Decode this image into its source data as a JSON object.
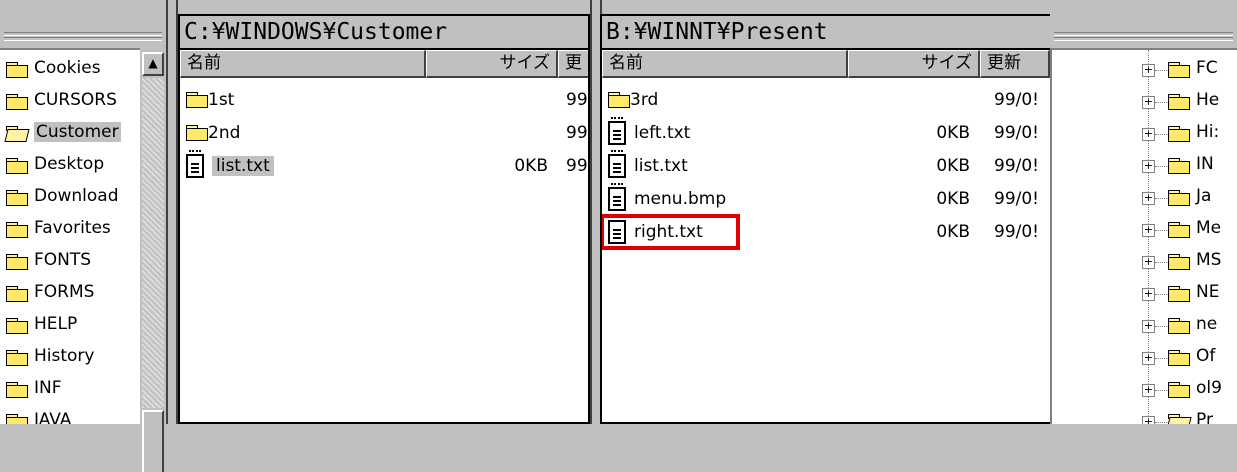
{
  "left_tree": {
    "items": [
      {
        "label": "Cookies",
        "selected": false
      },
      {
        "label": "CURSORS",
        "selected": false
      },
      {
        "label": "Customer",
        "selected": true
      },
      {
        "label": "Desktop",
        "selected": false
      },
      {
        "label": "Download",
        "selected": false
      },
      {
        "label": "Favorites",
        "selected": false
      },
      {
        "label": "FONTS",
        "selected": false
      },
      {
        "label": "FORMS",
        "selected": false
      },
      {
        "label": "HELP",
        "selected": false
      },
      {
        "label": "History",
        "selected": false
      },
      {
        "label": "INF",
        "selected": false
      },
      {
        "label": "JAVA",
        "selected": false
      }
    ],
    "scroll_up_glyph": "▲"
  },
  "left_panel": {
    "path": "C:¥WINDOWS¥Customer",
    "headers": {
      "name": "名前",
      "size": "サイズ",
      "date": "更"
    },
    "rows": [
      {
        "type": "folder",
        "name": "1st",
        "size": "",
        "date": "99"
      },
      {
        "type": "folder",
        "name": "2nd",
        "size": "",
        "date": "99"
      },
      {
        "type": "file",
        "name": "list.txt",
        "size": "0KB",
        "date": "99",
        "selected": true
      }
    ]
  },
  "right_panel": {
    "path": "B:¥WINNT¥Present",
    "headers": {
      "name": "名前",
      "size": "サイズ",
      "date": "更新"
    },
    "rows": [
      {
        "type": "folder",
        "name": "3rd",
        "size": "",
        "date": "99/0!"
      },
      {
        "type": "file",
        "name": "left.txt",
        "size": "0KB",
        "date": "99/0!"
      },
      {
        "type": "file",
        "name": "list.txt",
        "size": "0KB",
        "date": "99/0!"
      },
      {
        "type": "file",
        "name": "menu.bmp",
        "size": "0KB",
        "date": "99/0!"
      },
      {
        "type": "file",
        "name": "right.txt",
        "size": "0KB",
        "date": "99/0!",
        "highlighted": true
      }
    ]
  },
  "right_tree": {
    "items": [
      {
        "label": "FC"
      },
      {
        "label": "He"
      },
      {
        "label": "Hi:"
      },
      {
        "label": "IN"
      },
      {
        "label": "Ja"
      },
      {
        "label": "Me"
      },
      {
        "label": "MS"
      },
      {
        "label": "NE"
      },
      {
        "label": "ne"
      },
      {
        "label": "Of"
      },
      {
        "label": "ol9"
      },
      {
        "label": "Pr"
      }
    ],
    "plus_glyph": "+"
  },
  "colors": {
    "highlight": "#e00000",
    "face": "#c0c0c0",
    "folder": "#ffe96a"
  }
}
